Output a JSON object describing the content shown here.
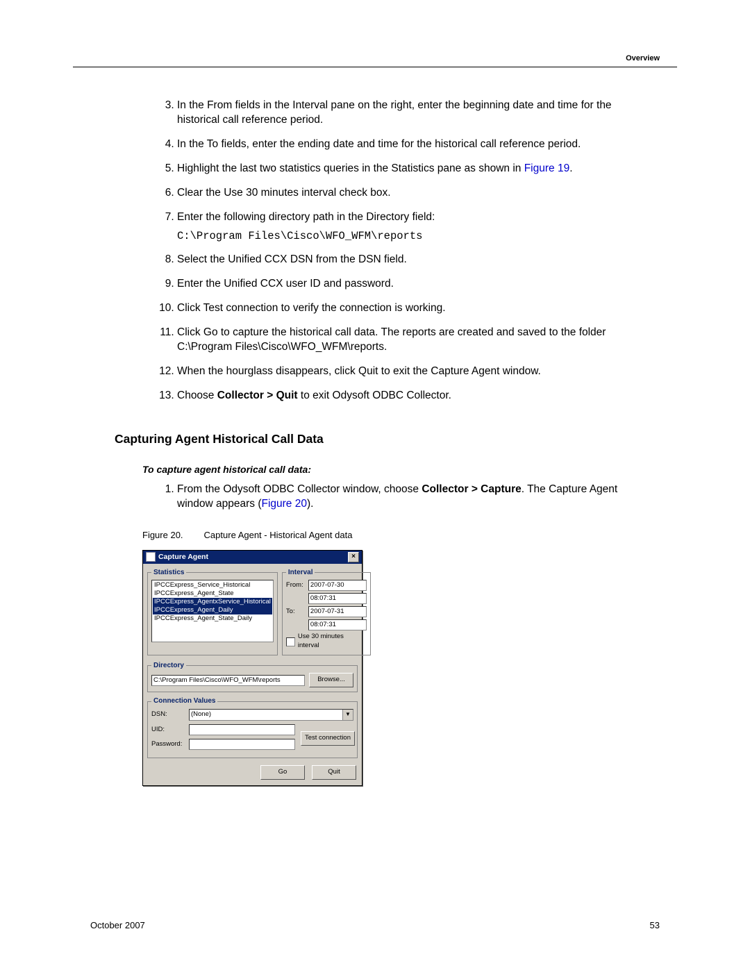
{
  "header": {
    "section": "Overview"
  },
  "steps_a": {
    "start": 3,
    "items": [
      {
        "text": "In the From fields in the Interval pane on the right, enter the beginning date and time for the historical call reference period."
      },
      {
        "text": "In the To fields, enter the ending date and time for the historical call reference period."
      },
      {
        "text": "Highlight the last two statistics queries in the Statistics pane as shown in ",
        "link": "Figure 19",
        "after": "."
      },
      {
        "text": "Clear the Use 30 minutes interval check box."
      },
      {
        "text": "Enter the following directory path in the Directory field:",
        "code": "C:\\Program Files\\Cisco\\WFO_WFM\\reports"
      },
      {
        "text": "Select the Unified CCX DSN from the DSN field."
      },
      {
        "text": "Enter the Unified CCX user ID and password."
      },
      {
        "text": "Click Test connection to verify the connection is working."
      },
      {
        "text": "Click Go to capture the historical call data. The reports are created and saved to the folder C:\\Program Files\\Cisco\\WFO_WFM\\reports."
      },
      {
        "text": "When the hourglass disappears, click Quit to exit the Capture Agent window."
      },
      {
        "pre": "Choose ",
        "bold": "Collector > Quit",
        "post": " to exit Odysoft ODBC Collector."
      }
    ]
  },
  "section_heading": "Capturing Agent Historical Call Data",
  "subhead": "To capture agent historical call data:",
  "steps_b": {
    "items": [
      {
        "pre": "From the Odysoft ODBC Collector window, choose ",
        "bold": "Collector > Capture",
        "post": ". The Capture Agent window appears (",
        "link": "Figure 20",
        "after": ")."
      }
    ]
  },
  "figure": {
    "num": "Figure 20.",
    "caption": "Capture Agent - Historical Agent data"
  },
  "dialog": {
    "title": "Capture Agent",
    "groups": {
      "stats": "Statistics",
      "interval": "Interval",
      "directory": "Directory",
      "conn": "Connection Values"
    },
    "stats_items": [
      {
        "label": "IPCCExpress_Service_Historical",
        "selected": false
      },
      {
        "label": "IPCCExpress_Agent_State",
        "selected": false
      },
      {
        "label": "IPCCExpress_AgentxService_Historical",
        "selected": true
      },
      {
        "label": "IPCCExpress_Agent_Daily",
        "selected": true
      },
      {
        "label": "IPCCExpress_Agent_State_Daily",
        "selected": false
      }
    ],
    "interval": {
      "from_label": "From:",
      "to_label": "To:",
      "from_date": "2007-07-30",
      "from_time": "08:07:31",
      "to_date": "2007-07-31",
      "to_time": "08:07:31",
      "checkbox": "Use 30 minutes interval"
    },
    "directory_value": "C:\\Program Files\\Cisco\\WFO_WFM\\reports",
    "browse": "Browse...",
    "conn": {
      "dsn_label": "DSN:",
      "dsn_value": "(None)",
      "uid_label": "UID:",
      "pwd_label": "Password:",
      "test": "Test connection"
    },
    "go": "Go",
    "quit": "Quit"
  },
  "footer": {
    "left": "October 2007",
    "right": "53"
  }
}
